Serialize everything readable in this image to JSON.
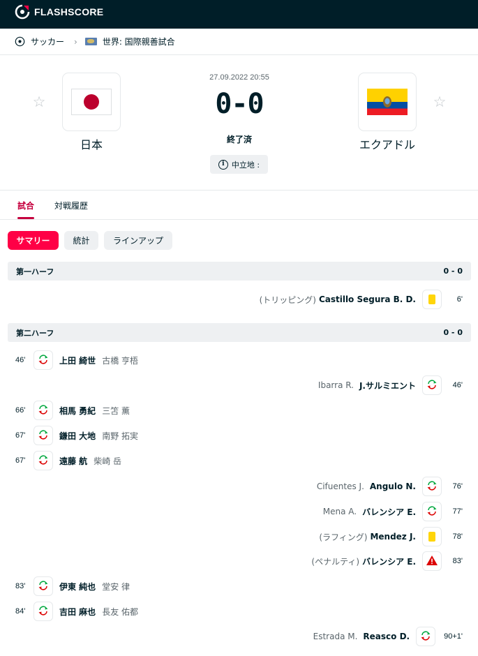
{
  "header": {
    "logo_text": "FLASHSCORE",
    "bg_color": "#001e28"
  },
  "breadcrumb": {
    "sport": "サッカー",
    "competition": "世界: 国際親善試合"
  },
  "match": {
    "home": {
      "name": "日本"
    },
    "away": {
      "name": "エクアドル"
    },
    "date": "27.09.2022 20:55",
    "score": "0-0",
    "status": "終了済",
    "venue_label": "中立地 :"
  },
  "tabs": [
    {
      "label": "試合",
      "active": true
    },
    {
      "label": "対戦履歴",
      "active": false
    }
  ],
  "subtabs": [
    {
      "label": "サマリー",
      "active": true
    },
    {
      "label": "統計",
      "active": false
    },
    {
      "label": "ラインアップ",
      "active": false
    }
  ],
  "sections": [
    {
      "title": "第一ハーフ",
      "score": "0 - 0"
    },
    {
      "title": "第二ハーフ",
      "score": "0 - 0"
    }
  ],
  "incidents": [
    {
      "side": "away",
      "minute": "6'",
      "type": "yellow",
      "player": "Castillo Segura B. D.",
      "desc": "(トリッピング)"
    },
    {
      "side": "home",
      "minute": "46'",
      "type": "sub",
      "player": "上田 綺世",
      "sub": "古橋 亨梧"
    },
    {
      "side": "away",
      "minute": "46'",
      "type": "sub",
      "player": "J.サルミエント",
      "sub": "Ibarra R."
    },
    {
      "side": "home",
      "minute": "66'",
      "type": "sub",
      "player": "相馬 勇紀",
      "sub": "三笘 薫"
    },
    {
      "side": "home",
      "minute": "67'",
      "type": "sub",
      "player": "鎌田 大地",
      "sub": "南野 拓実"
    },
    {
      "side": "home",
      "minute": "67'",
      "type": "sub",
      "player": "遠藤 航",
      "sub": "柴崎 岳"
    },
    {
      "side": "away",
      "minute": "76'",
      "type": "sub",
      "player": "Angulo N.",
      "sub": "Cifuentes J."
    },
    {
      "side": "away",
      "minute": "77'",
      "type": "sub",
      "player": "バレンシア E.",
      "sub": "Mena A."
    },
    {
      "side": "away",
      "minute": "78'",
      "type": "yellow",
      "player": "Mendez J.",
      "desc": "(ラフィング)"
    },
    {
      "side": "away",
      "minute": "83'",
      "type": "penalty-miss",
      "player": "バレンシア E.",
      "desc": "(ペナルティ)"
    },
    {
      "side": "home",
      "minute": "83'",
      "type": "sub",
      "player": "伊東 純也",
      "sub": "堂安 律"
    },
    {
      "side": "home",
      "minute": "84'",
      "type": "sub",
      "player": "吉田 麻也",
      "sub": "長友 佑都"
    },
    {
      "side": "away",
      "minute": "90+1'",
      "type": "sub",
      "player": "Reasco D.",
      "sub": "Estrada M."
    }
  ],
  "colors": {
    "accent": "#ff0046",
    "tab_active": "#c5003e",
    "yellow_card": "#ffd50a",
    "penalty_miss": "#dc0000",
    "sub_in": "#00a83f",
    "sub_out": "#dc0000"
  }
}
